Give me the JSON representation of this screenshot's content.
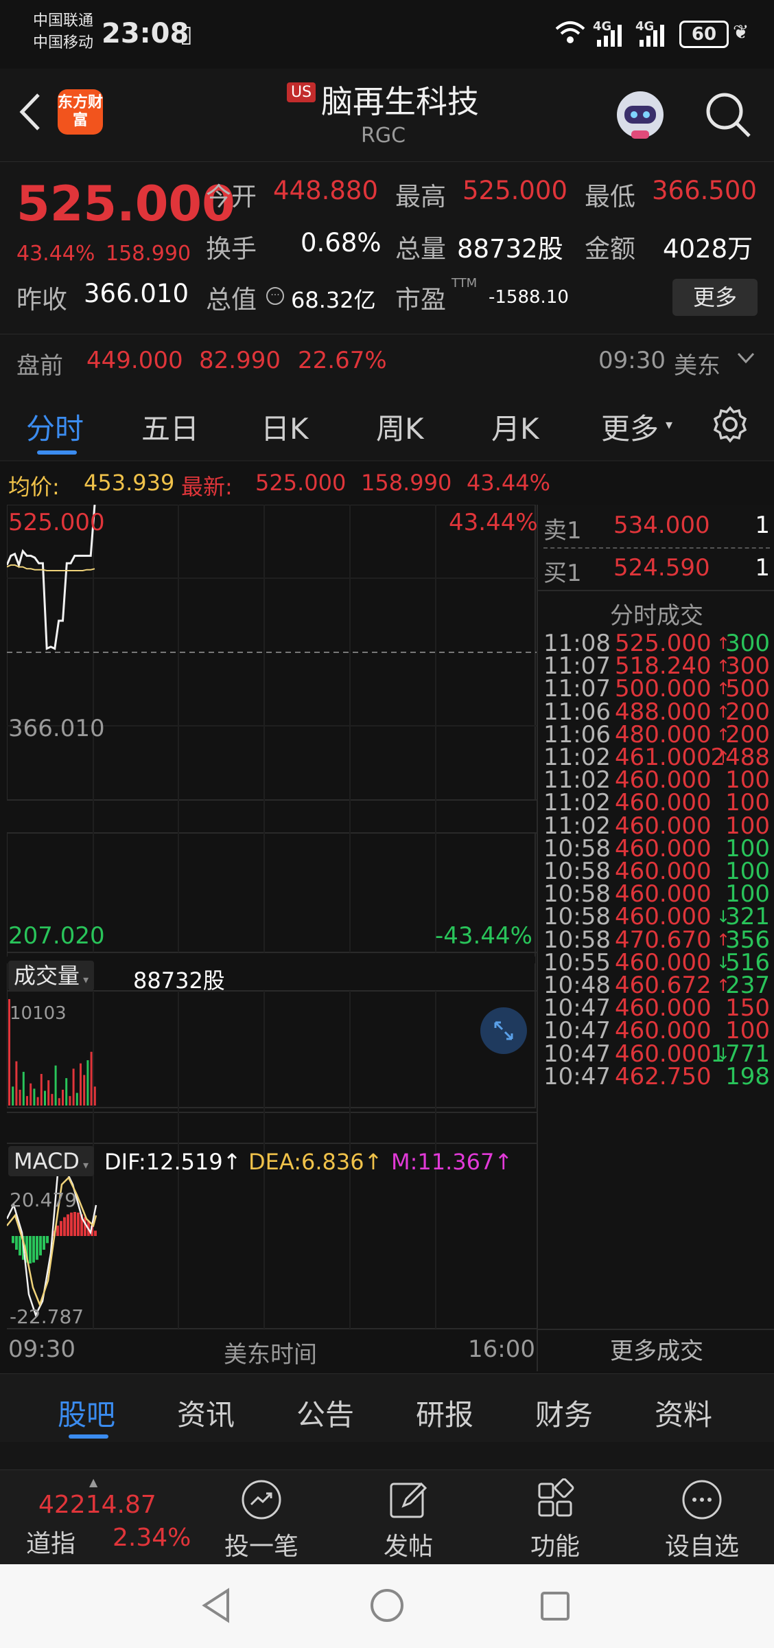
{
  "status_bar": {
    "carrier1": "中国联通",
    "carrier2": "中国移动",
    "time": "23:08",
    "signal1": "4G",
    "signal2": "4G",
    "battery": "60"
  },
  "header": {
    "logo_text": "东方财富",
    "market_badge": "US",
    "stock_name": "脑再生科技",
    "ticker": "RGC"
  },
  "quote": {
    "price": "525.000",
    "change_pct": "43.44%",
    "change_amt": "158.990",
    "open_label": "今开",
    "open": "448.880",
    "high_label": "最高",
    "high": "525.000",
    "low_label": "最低",
    "low": "366.500",
    "turnover_label": "换手",
    "turnover": "0.68%",
    "volume_label": "总量",
    "volume": "88732股",
    "amount_label": "金额",
    "amount": "4028万",
    "prev_close_label": "昨收",
    "prev_close": "366.010",
    "mktcap_label": "总值",
    "mktcap": "68.32亿",
    "pe_label": "市盈",
    "pe_sup": "TTM",
    "pe": "-1588.10",
    "more_button": "更多"
  },
  "premarket": {
    "label": "盘前",
    "price": "449.000",
    "change": "82.990",
    "pct": "22.67%",
    "time": "09:30",
    "region": "美东"
  },
  "tabs": [
    "分时",
    "五日",
    "日K",
    "周K",
    "月K",
    "更多"
  ],
  "info_row": {
    "avg_label": "均价:",
    "avg": "453.939",
    "latest_label": "最新:",
    "latest": "525.000",
    "chg": "158.990",
    "pct": "43.44%"
  },
  "chart": {
    "top_price": "525.000",
    "top_pct": "43.44%",
    "mid_price": "366.010",
    "bottom_price": "207.020",
    "bottom_pct": "-43.44%",
    "volume_label": "成交量",
    "volume_value": "88732股",
    "volume_max": "10103",
    "macd_label": "MACD",
    "dif": "DIF:12.519",
    "dea": "DEA:6.836",
    "m": "M:11.367",
    "macd_top": "20.479",
    "macd_bottom": "-22.787",
    "time_start": "09:30",
    "time_mid": "美东时间",
    "time_end": "16:00",
    "price_line_values": [
      460,
      470,
      472,
      460,
      475,
      470,
      470,
      468,
      462,
      462,
      370,
      372,
      370,
      400,
      400,
      462,
      462,
      470,
      470,
      470,
      470,
      470,
      525
    ],
    "avg_line_values": [
      458,
      460,
      460,
      458,
      458,
      456,
      456,
      455,
      455,
      455,
      454,
      454,
      454,
      454,
      454,
      454,
      454,
      454,
      454,
      454,
      455,
      455,
      456
    ],
    "volume_values": [
      10103,
      1800,
      4200,
      1500,
      3200,
      900,
      2100,
      1600,
      800,
      3000,
      1400,
      2400,
      1100,
      3800,
      700,
      1500,
      2600,
      900,
      3500,
      1200,
      4000,
      2900,
      4300,
      5100,
      1800
    ]
  },
  "order_book": {
    "ask_label": "卖1",
    "ask_price": "534.000",
    "ask_qty": "1",
    "bid_label": "买1",
    "bid_price": "524.590",
    "bid_qty": "1",
    "ticks_title": "分时成交",
    "more_trades": "更多成交",
    "trades": [
      {
        "time": "11:08",
        "price": "525.000",
        "dir": "↑",
        "qty": "300",
        "qty_color": "green"
      },
      {
        "time": "11:07",
        "price": "518.240",
        "dir": "↑",
        "qty": "300",
        "qty_color": "red"
      },
      {
        "time": "11:07",
        "price": "500.000",
        "dir": "↑",
        "qty": "500",
        "qty_color": "red"
      },
      {
        "time": "11:06",
        "price": "488.000",
        "dir": "↑",
        "qty": "200",
        "qty_color": "red"
      },
      {
        "time": "11:06",
        "price": "480.000",
        "dir": "↑",
        "qty": "200",
        "qty_color": "red"
      },
      {
        "time": "11:02",
        "price": "461.000",
        "dir": "↑",
        "qty": "2488",
        "qty_color": "red"
      },
      {
        "time": "11:02",
        "price": "460.000",
        "dir": "",
        "qty": "100",
        "qty_color": "red"
      },
      {
        "time": "11:02",
        "price": "460.000",
        "dir": "",
        "qty": "100",
        "qty_color": "red"
      },
      {
        "time": "11:02",
        "price": "460.000",
        "dir": "",
        "qty": "100",
        "qty_color": "red"
      },
      {
        "time": "10:58",
        "price": "460.000",
        "dir": "",
        "qty": "100",
        "qty_color": "green"
      },
      {
        "time": "10:58",
        "price": "460.000",
        "dir": "",
        "qty": "100",
        "qty_color": "green"
      },
      {
        "time": "10:58",
        "price": "460.000",
        "dir": "",
        "qty": "100",
        "qty_color": "green"
      },
      {
        "time": "10:58",
        "price": "460.000",
        "dir": "↓",
        "qty": "321",
        "qty_color": "green"
      },
      {
        "time": "10:58",
        "price": "470.670",
        "dir": "↑",
        "qty": "356",
        "qty_color": "green"
      },
      {
        "time": "10:55",
        "price": "460.000",
        "dir": "↓",
        "qty": "516",
        "qty_color": "green"
      },
      {
        "time": "10:48",
        "price": "460.672",
        "dir": "↑",
        "qty": "237",
        "qty_color": "green"
      },
      {
        "time": "10:47",
        "price": "460.000",
        "dir": "",
        "qty": "150",
        "qty_color": "red"
      },
      {
        "time": "10:47",
        "price": "460.000",
        "dir": "",
        "qty": "100",
        "qty_color": "red"
      },
      {
        "time": "10:47",
        "price": "460.000",
        "dir": "↓",
        "qty": "1771",
        "qty_color": "green"
      },
      {
        "time": "10:47",
        "price": "462.750",
        "dir": "",
        "qty": "198",
        "qty_color": "green"
      }
    ]
  },
  "bottom_tabs": [
    "股吧",
    "资讯",
    "公告",
    "研报",
    "财务",
    "资料"
  ],
  "toolbar": {
    "index_value": "42214.87",
    "index_name": "道指",
    "index_pct": "2.34%",
    "tools": [
      "投一笔",
      "发帖",
      "功能",
      "设自选"
    ]
  },
  "colors": {
    "up": "#e0353a",
    "down": "#29c45a",
    "accent": "#3b8cf0",
    "avg_line": "#f0d37a"
  }
}
